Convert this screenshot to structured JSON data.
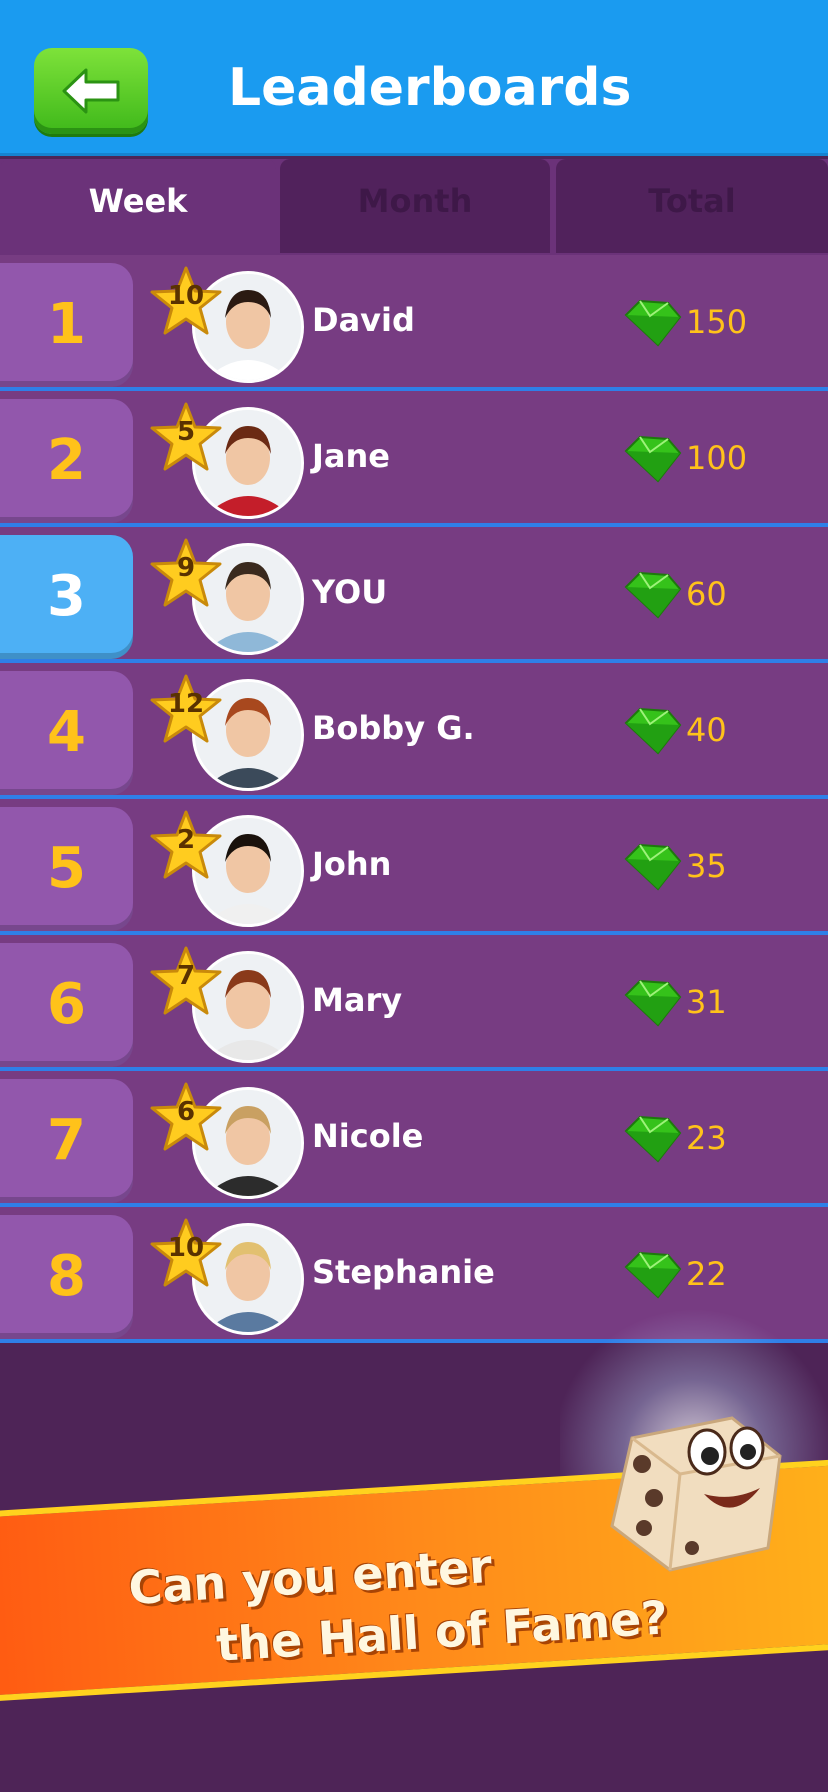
{
  "header": {
    "title": "Leaderboards",
    "back_icon": "arrow-left-icon",
    "colors": {
      "bar": "#1a9bf0",
      "back_button": "#4fc21f"
    }
  },
  "tabs": [
    {
      "label": "Week",
      "active": true
    },
    {
      "label": "Month",
      "active": false
    },
    {
      "label": "Total",
      "active": false
    }
  ],
  "leaderboard": {
    "rows": [
      {
        "rank": "1",
        "level": "10",
        "name": "David",
        "score": "150",
        "is_you": false
      },
      {
        "rank": "2",
        "level": "5",
        "name": "Jane",
        "score": "100",
        "is_you": false
      },
      {
        "rank": "3",
        "level": "9",
        "name": "YOU",
        "score": "60",
        "is_you": true
      },
      {
        "rank": "4",
        "level": "12",
        "name": "Bobby G.",
        "score": "40",
        "is_you": false
      },
      {
        "rank": "5",
        "level": "2",
        "name": "John",
        "score": "35",
        "is_you": false
      },
      {
        "rank": "6",
        "level": "7",
        "name": "Mary",
        "score": "31",
        "is_you": false
      },
      {
        "rank": "7",
        "level": "6",
        "name": "Nicole",
        "score": "23",
        "is_you": false
      },
      {
        "rank": "8",
        "level": "10",
        "name": "Stephanie",
        "score": "22",
        "is_you": false
      }
    ],
    "score_icon": "green-gem-icon",
    "level_icon": "gold-star-icon",
    "colors": {
      "row": "#773c82",
      "rank_tile": "#9257ac",
      "you_tile": "#4db0f5",
      "rank_text": "#ffc21a",
      "divider": "#2f7fe8"
    }
  },
  "promo": {
    "line1": "Can you enter",
    "line2": "the Hall of Fame?",
    "mascot_icon": "dice-mascot-icon"
  }
}
